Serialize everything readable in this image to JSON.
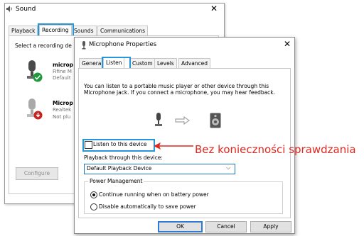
{
  "sound_window": {
    "title": "Sound",
    "tabs": [
      "Playback",
      "Recording",
      "Sounds",
      "Communications"
    ],
    "select_text": "Select a recording de",
    "devices": [
      {
        "name": "microp",
        "line1": "Fifine M",
        "line2": "Default"
      },
      {
        "name": "Microp",
        "line1": "Realtek",
        "line2": "Not plu"
      }
    ],
    "configure_label": "Configure"
  },
  "mic_window": {
    "title": "Microphone Properties",
    "tabs": [
      "General",
      "Listen",
      "Custom",
      "Levels",
      "Advanced"
    ],
    "description": "You can listen to a portable music player or other device through this Microphone jack.  If you connect a microphone, you may hear feedback.",
    "listen_label": "Listen to this device",
    "playback_label": "Playback through this device:",
    "playback_value": "Default Playback Device",
    "power_title": "Power Management",
    "power_options": [
      "Continue running when on battery power",
      "Disable automatically to save power"
    ],
    "buttons": {
      "ok": "OK",
      "cancel": "Cancel",
      "apply": "Apply"
    }
  },
  "annotation": {
    "text": "Bez konieczności sprawdzania",
    "color": "#e0271f"
  },
  "colors": {
    "highlight": "#2596d9",
    "accent_blue": "#1a73c0"
  },
  "icons": [
    "speaker-icon",
    "microphone-icon",
    "check-badge-icon",
    "unplugged-badge-icon",
    "arrow-right-icon",
    "speaker-box-icon",
    "close-icon",
    "chevron-down-icon"
  ]
}
